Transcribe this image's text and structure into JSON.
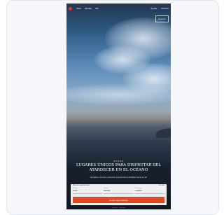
{
  "nav": {
    "links": [
      "Inicio",
      "Ofertas",
      "Info"
    ],
    "right": [
      "Ayuda",
      "Acceder"
    ]
  },
  "side_button": "Reservar",
  "hero": {
    "eyebrow": "★★★★★",
    "title": "LUGARES ÚNICOS PARA DISFRUTAR DEL ATARDECER EN EL OCÉANO",
    "subtitle": "Escápate a la costa y descubre experiencias inolvidables frente al mar"
  },
  "booking": {
    "header_left": "Busca tu estancia ideal",
    "header_right": "Ver más",
    "fields": [
      {
        "label": "Destino",
        "value": "Costa"
      },
      {
        "label": "Fechas",
        "value": "Entrada"
      },
      {
        "label": "Huéspedes",
        "value": "2 adultos"
      }
    ],
    "cta": "Buscar disponibilidad"
  },
  "footer": "Términos · Privacidad"
}
